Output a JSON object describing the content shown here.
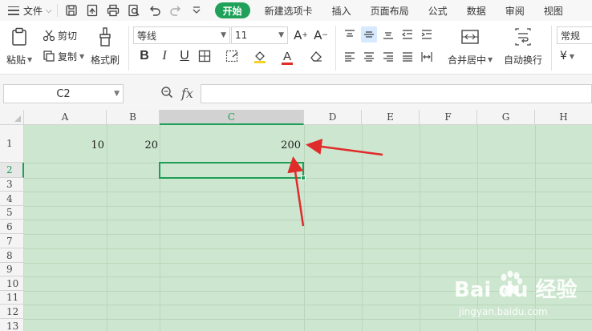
{
  "menubar": {
    "file_label": "文件",
    "tabs": [
      "开始",
      "新建选项卡",
      "插入",
      "页面布局",
      "公式",
      "数据",
      "审阅",
      "视图"
    ],
    "active_tab": "开始"
  },
  "ribbon": {
    "paste_label": "粘贴",
    "cut_label": "剪切",
    "copy_label": "复制",
    "format_painter_label": "格式刷",
    "font_name": "等线",
    "font_size": "11",
    "merge_center_label": "合并居中",
    "wrap_text_label": "自动换行",
    "number_format": "常规",
    "currency_symbol": "¥"
  },
  "formula_bar": {
    "name_box": "C2",
    "fx_label": "fx",
    "formula_value": ""
  },
  "sheet": {
    "columns": [
      "A",
      "B",
      "C",
      "D",
      "E",
      "F",
      "G",
      "H"
    ],
    "active_column": "C",
    "rows": [
      "1",
      "2",
      "3",
      "4",
      "5",
      "6",
      "7",
      "8",
      "9",
      "10",
      "11",
      "12",
      "13"
    ],
    "active_row": "2",
    "cells": {
      "A1": "10",
      "B1": "20",
      "C1": "200"
    },
    "selected_cell": "C2"
  },
  "watermark": {
    "brand": "Bai du 经验",
    "url": "jingyan.baidu.com"
  },
  "colors": {
    "accent_green": "#1fa15a",
    "grid_fill": "#cde6cf",
    "arrow_red": "#e02b2b"
  }
}
